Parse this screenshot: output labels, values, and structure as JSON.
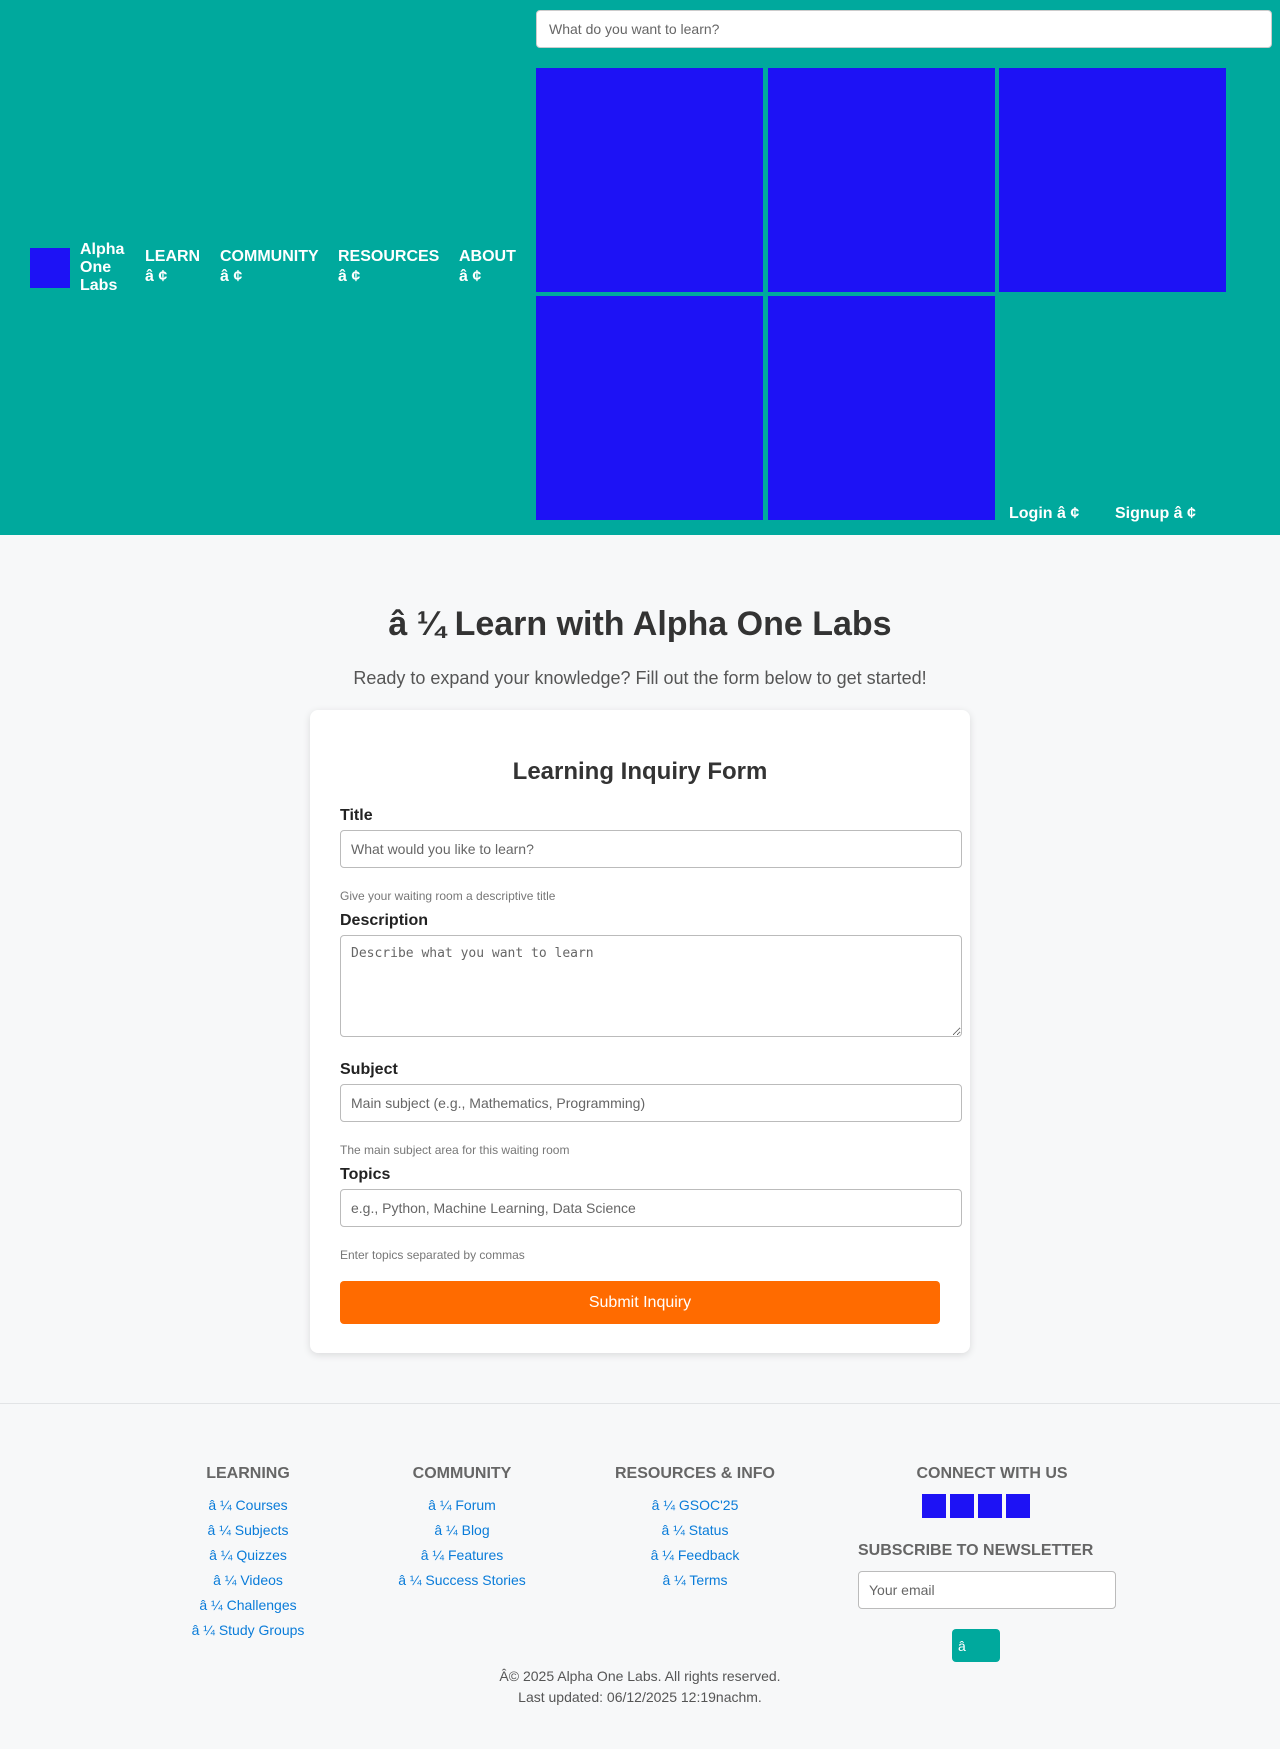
{
  "header": {
    "brand": "Alpha One Labs",
    "nav": [
      {
        "label": "LEARN",
        "glyph": "â ¢"
      },
      {
        "label": "COMMUNITY",
        "glyph": "â ¢"
      },
      {
        "label": "RESOURCES",
        "glyph": "â ¢"
      },
      {
        "label": "ABOUT",
        "glyph": "â ¢"
      }
    ],
    "search_placeholder": "What do you want to learn?",
    "login": "Login â ¢",
    "signup": "Signup â ¢",
    "tile_color": "#1d12f5",
    "bg_color": "#00a99d"
  },
  "hero": {
    "title": "â ¼ Learn with Alpha One Labs",
    "subtitle": "Ready to expand your knowledge? Fill out the form below to get started!"
  },
  "form": {
    "title": "Learning Inquiry Form",
    "fields": {
      "title": {
        "label": "Title",
        "placeholder": "What would you like to learn?",
        "help": "Give your waiting room a descriptive title"
      },
      "description": {
        "label": "Description",
        "placeholder": "Describe what you want to learn"
      },
      "subject": {
        "label": "Subject",
        "placeholder": "Main subject (e.g., Mathematics, Programming)",
        "help": "The main subject area for this waiting room"
      },
      "topics": {
        "label": "Topics",
        "placeholder": "e.g., Python, Machine Learning, Data Science",
        "help": "Enter topics separated by commas"
      }
    },
    "submit": "Submit Inquiry",
    "submit_color": "#ff6b00"
  },
  "footer": {
    "learning": {
      "heading": "LEARNING",
      "links": [
        "â ¼ Courses",
        "â ¼ Subjects",
        "â ¼ Quizzes",
        "â ¼ Videos",
        "â ¼ Challenges",
        "â ¼ Study Groups"
      ]
    },
    "community": {
      "heading": "COMMUNITY",
      "links": [
        "â ¼ Forum",
        "â ¼ Blog",
        "â ¼ Features",
        "â ¼ Success Stories"
      ]
    },
    "resources": {
      "heading": "RESOURCES & INFO",
      "links": [
        "â ¼ GSOC'25",
        "â ¼ Status",
        "â ¼ Feedback",
        "â ¼ Terms"
      ]
    },
    "connect": {
      "heading": "CONNECT WITH US"
    },
    "newsletter": {
      "heading": "SUBSCRIBE TO NEWSLETTER",
      "placeholder": "Your email",
      "button": "â"
    },
    "copyright": "Â© 2025 Alpha One Labs. All rights reserved.",
    "updated": "Last updated: 06/12/2025 12:19nachm."
  }
}
